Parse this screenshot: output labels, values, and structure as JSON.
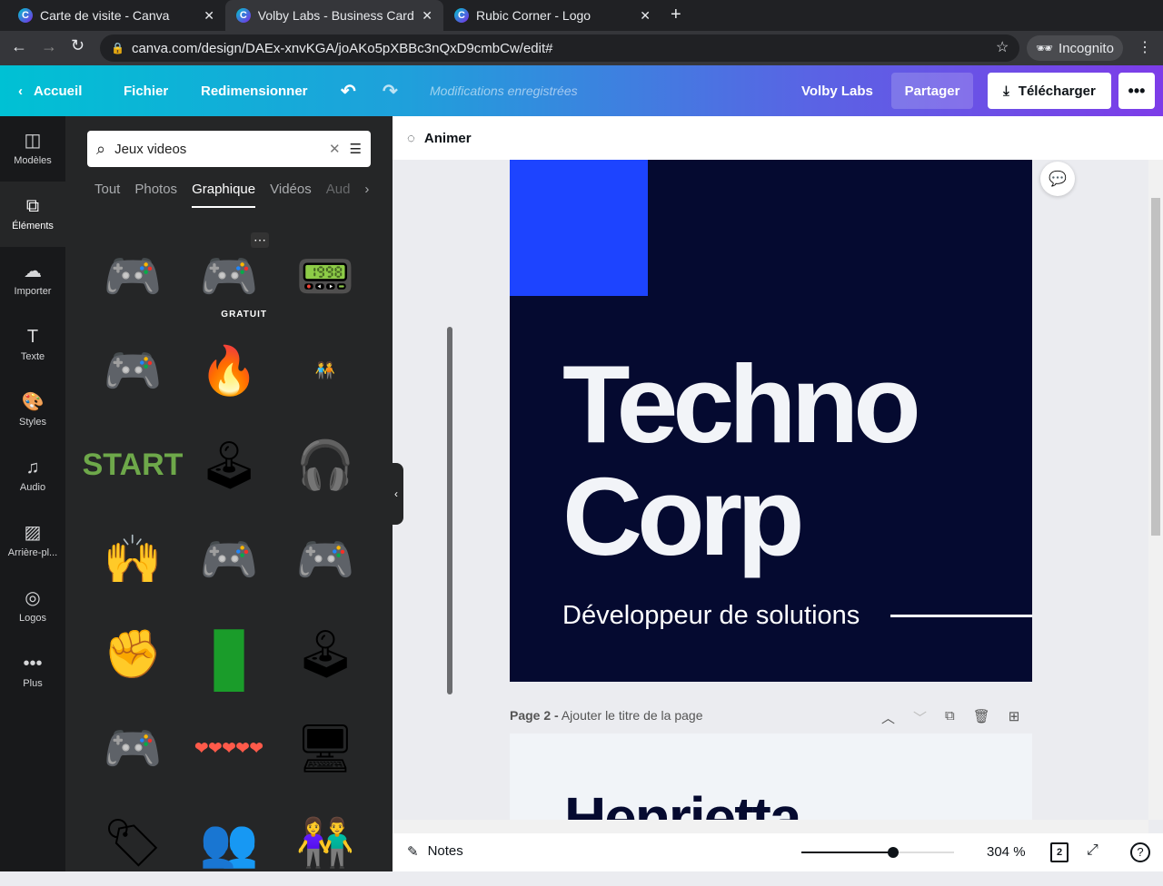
{
  "browser": {
    "tabs": [
      {
        "title": "Carte de visite - Canva"
      },
      {
        "title": "Volby Labs - Business Card"
      },
      {
        "title": "Rubic Corner - Logo"
      }
    ],
    "url": "canva.com/design/DAEx-xnvKGA/joAKo5pXBBc3nQxD9cmbCw/edit#",
    "profile": "Incognito"
  },
  "header": {
    "home": "Accueil",
    "file": "Fichier",
    "resize": "Redimensionner",
    "status": "Modifications enregistrées",
    "team": "Volby Labs",
    "share": "Partager",
    "download": "Télécharger"
  },
  "rail": [
    {
      "label": "Modèles"
    },
    {
      "label": "Éléments"
    },
    {
      "label": "Importer"
    },
    {
      "label": "Texte"
    },
    {
      "label": "Styles"
    },
    {
      "label": "Audio"
    },
    {
      "label": "Arrière-pl..."
    },
    {
      "label": "Logos"
    },
    {
      "label": "Plus"
    }
  ],
  "panel": {
    "search_value": "Jeux videos",
    "tabs": [
      "Tout",
      "Photos",
      "Graphique",
      "Vidéos",
      "Aud"
    ],
    "free_badge": "GRATUIT",
    "graphics": [
      {
        "name": "gamepad-grey",
        "glyph": "🎮"
      },
      {
        "name": "gamepad-white",
        "glyph": "🎮"
      },
      {
        "name": "handheld-console",
        "glyph": "📟"
      },
      {
        "name": "gamepad-teal",
        "glyph": "🎮"
      },
      {
        "name": "gamepad-fire",
        "glyph": "🔥"
      },
      {
        "name": "gamers-people",
        "glyph": "🧑‍🤝‍🧑"
      },
      {
        "name": "start-text",
        "glyph": "START"
      },
      {
        "name": "console-ps5",
        "glyph": "🕹"
      },
      {
        "name": "headset",
        "glyph": "🎧"
      },
      {
        "name": "hands-handheld",
        "glyph": "🙌"
      },
      {
        "name": "gamepad-black",
        "glyph": "🎮"
      },
      {
        "name": "hands-gamepad",
        "glyph": "🎮"
      },
      {
        "name": "hand-gamepad",
        "glyph": "✊"
      },
      {
        "name": "green-pipe",
        "glyph": "▮"
      },
      {
        "name": "gamepad-yellow",
        "glyph": "🕹"
      },
      {
        "name": "gamepad-outline",
        "glyph": "🎮"
      },
      {
        "name": "hearts",
        "glyph": "❤❤❤❤❤"
      },
      {
        "name": "gamer-desk",
        "glyph": "🖥"
      },
      {
        "name": "buy-now",
        "glyph": "🏷"
      },
      {
        "name": "people-couch",
        "glyph": "👥"
      },
      {
        "name": "people-gaming",
        "glyph": "👫"
      }
    ]
  },
  "toolbar": {
    "animate": "Animer"
  },
  "page1": {
    "line1": "Techno",
    "line2": "Corp",
    "subtitle": "Développeur de solutions"
  },
  "page2": {
    "label_num": "Page 2 -",
    "label_title": "Ajouter le titre de la page",
    "heading": "Henrietta"
  },
  "bottom": {
    "notes": "Notes",
    "zoom": "304 %",
    "zoom_fraction": 0.6,
    "pages": "2"
  },
  "colors": {
    "page_bg": "#050a30",
    "accent_square": "#1d44ff"
  }
}
